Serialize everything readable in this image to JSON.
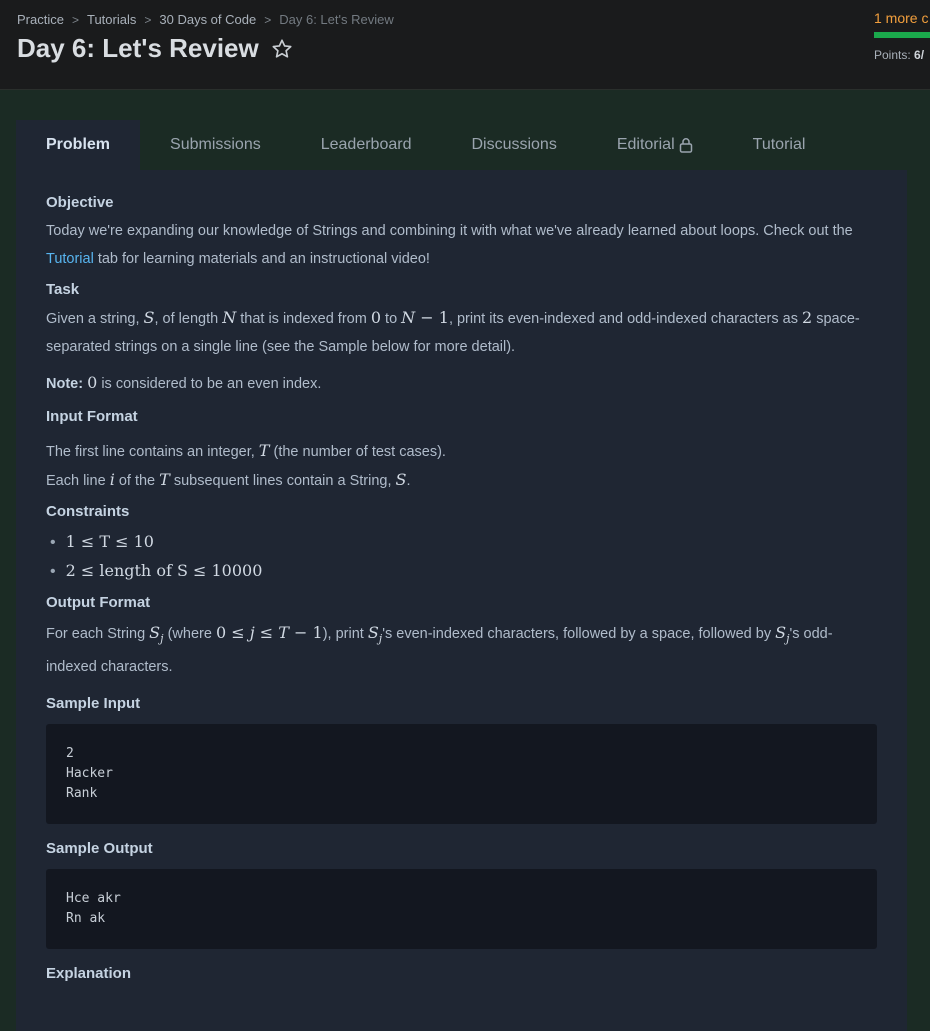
{
  "breadcrumb": {
    "items": [
      "Practice",
      "Tutorials",
      "30 Days of Code"
    ],
    "current": "Day 6: Let's Review"
  },
  "title": "Day 6: Let's Review",
  "progress": {
    "more_label": "1 more c",
    "points_label": "Points:",
    "points_value": "6/",
    "fill_fraction": 1.0,
    "color": "#1ba94c"
  },
  "tabs": [
    {
      "label": "Problem",
      "active": true
    },
    {
      "label": "Submissions",
      "active": false
    },
    {
      "label": "Leaderboard",
      "active": false
    },
    {
      "label": "Discussions",
      "active": false
    },
    {
      "label": "Editorial",
      "active": false,
      "icon": "lock-icon"
    },
    {
      "label": "Tutorial",
      "active": false
    }
  ],
  "objective": {
    "title": "Objective",
    "text_before": "Today we're expanding our knowledge of Strings and combining it with what we've already learned about loops. Check out the ",
    "link": "Tutorial",
    "text_after": " tab for learning materials and an instructional video!"
  },
  "task": {
    "title": "Task",
    "p1": "Given a string,",
    "p2": ", of length",
    "p3": "that is indexed from",
    "p4": "to",
    "p5": ", print its even-indexed and odd-indexed characters as",
    "p6": "space-separated strings on a single line (see the Sample below for more detail).",
    "note_label": "Note:",
    "note_text": "is considered to be an even index."
  },
  "input_format": {
    "title": "Input Format",
    "line1a": "The first line contains an integer,",
    "line1b": "(the number of test cases).",
    "line2a": "Each line",
    "line2b": "of the",
    "line2c": "subsequent lines contain a String,"
  },
  "constraints": {
    "title": "Constraints",
    "items": [
      "1 ≤ T ≤ 10",
      "2 ≤ length of S ≤ 10000"
    ]
  },
  "output_format": {
    "title": "Output Format",
    "a": "For each String",
    "b": "(where",
    "c": "), print",
    "d": "'s even-indexed characters, followed by a space, followed by",
    "e": "'s odd-indexed characters."
  },
  "sample_input": {
    "title": "Sample Input",
    "code": "2\nHacker\nRank"
  },
  "sample_output": {
    "title": "Sample Output",
    "code": "Hce akr\nRn ak"
  },
  "explanation": {
    "title": "Explanation"
  }
}
